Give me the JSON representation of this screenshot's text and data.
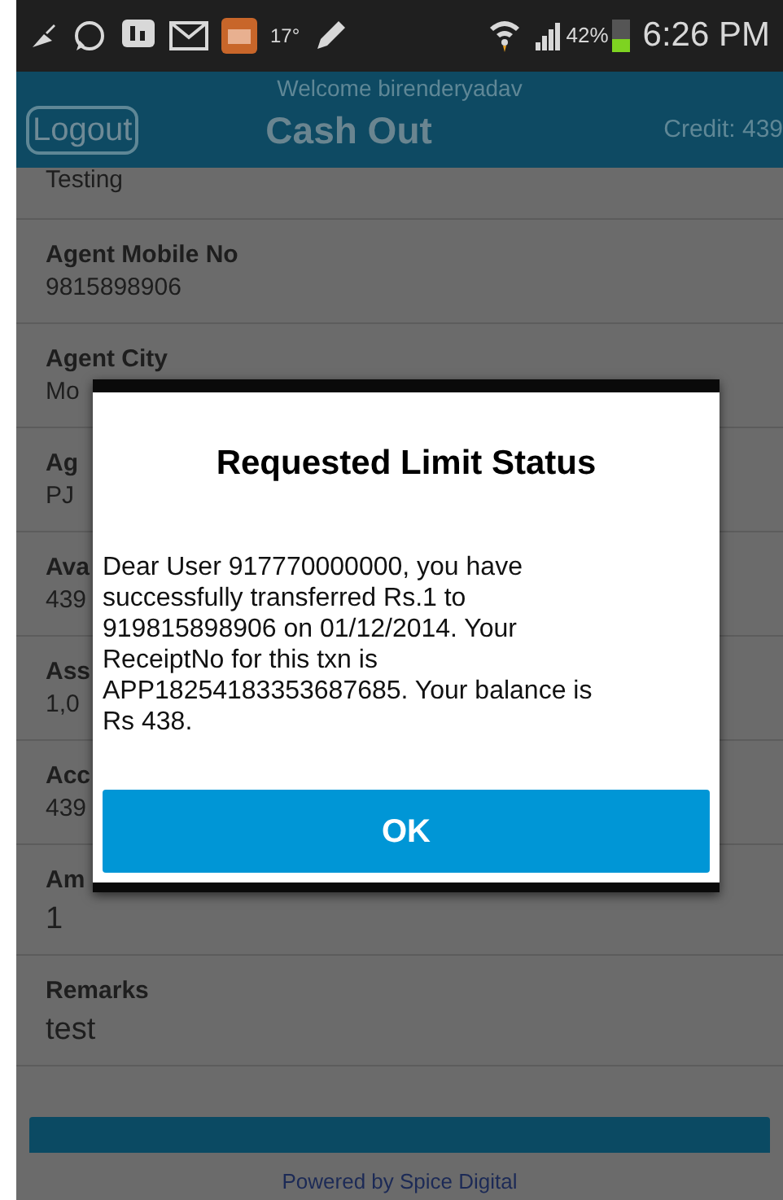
{
  "status_bar": {
    "temperature": "17°",
    "battery_percent": "42%",
    "time": "6:26 PM"
  },
  "header": {
    "welcome": "Welcome birenderyadav",
    "logout": "Logout",
    "title": "Cash Out",
    "credit": "Credit: 439"
  },
  "fields": [
    {
      "value": "Testing"
    },
    {
      "label": "Agent Mobile No",
      "value": "9815898906"
    },
    {
      "label": "Agent City",
      "value": "Mo"
    },
    {
      "label": "Ag",
      "value": "PJ"
    },
    {
      "label": "Ava",
      "value": "439"
    },
    {
      "label": "Ass",
      "value": "1,0"
    },
    {
      "label": "Acc",
      "value": "439"
    },
    {
      "label": "Am",
      "value": "1",
      "kind": "input"
    },
    {
      "label": "Remarks",
      "value": "test",
      "kind": "input"
    }
  ],
  "dialog": {
    "title": "Requested Limit Status",
    "message": "Dear User 917770000000, you have successfully transferred Rs.1 to 919815898906 on 01/12/2014. Your ReceiptNo for this txn is APP18254183353687685. Your balance is Rs 438.",
    "ok": "OK"
  },
  "footer": "Powered by Spice Digital"
}
